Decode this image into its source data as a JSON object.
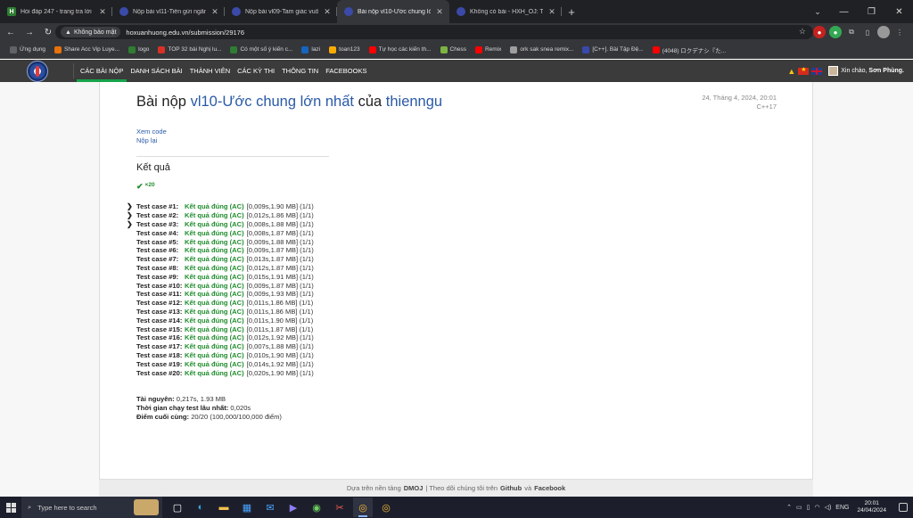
{
  "browser": {
    "tabs": [
      {
        "title": "Hỏi đáp 247 - trang tra lời",
        "favicon": "H",
        "active": false
      },
      {
        "title": "Nộp bài vl11-Tiền gửi ngân hà",
        "favicon": "",
        "active": false
      },
      {
        "title": "Nộp bài vl09-Tam giác vuông",
        "favicon": "",
        "active": false
      },
      {
        "title": "Bài nộp vl10-Ước chung lớn nh",
        "favicon": "",
        "active": true
      },
      {
        "title": "Không có bài - HXH_OJ: Trườn",
        "favicon": "",
        "active": false
      }
    ],
    "new_tab": "+",
    "security_label": "Không bảo mật",
    "url": "hoxuanhuong.edu.vn/submission/29176",
    "bookmarks": [
      {
        "label": "Ứng dụng",
        "icon": "apps-icon",
        "color": "#5f6368"
      },
      {
        "label": "Share Acc Vip Luye...",
        "icon": "share-icon",
        "color": "#e8710a"
      },
      {
        "label": "logo",
        "icon": "h-logo-icon",
        "color": "#2e7d32"
      },
      {
        "label": "TOP 32 bài Nghị lu...",
        "icon": "bookmark-icon",
        "color": "#d93025"
      },
      {
        "label": "Có một số ý kiến c...",
        "icon": "h-logo-icon",
        "color": "#2e7d32"
      },
      {
        "label": "lazi",
        "icon": "lazi-icon",
        "color": "#1565c0"
      },
      {
        "label": "toan123",
        "icon": "toan-icon",
        "color": "#f9ab00"
      },
      {
        "label": "Tự học các kiến th...",
        "icon": "youtube-icon",
        "color": "#ff0000"
      },
      {
        "label": "Chess",
        "icon": "chess-icon",
        "color": "#7cb342"
      },
      {
        "label": "Remix",
        "icon": "youtube-icon",
        "color": "#ff0000"
      },
      {
        "label": "ork sak snea remix...",
        "icon": "globe-icon",
        "color": "#9e9e9e"
      },
      {
        "label": "[C++]. Bài Tập Đệ...",
        "icon": "cpp-icon",
        "color": "#3949ab"
      },
      {
        "label": "(4048) ロクデナシ『た...",
        "icon": "youtube-icon",
        "color": "#ff0000"
      }
    ]
  },
  "site": {
    "menu": [
      "CÁC BÀI NỘP",
      "DANH SÁCH BÀI",
      "THÀNH VIÊN",
      "CÁC KỲ THI",
      "THÔNG TIN",
      "FACEBOOKS"
    ],
    "greeting_prefix": "Xin chào,",
    "user": "Sơn Phùng."
  },
  "submission": {
    "title_prefix": "Bài nộp",
    "problem": "vl10-Ước chung lớn nhất",
    "title_of": "của",
    "user": "thienngu",
    "date": "24, Tháng 4, 2024, 20:01",
    "language": "C++17",
    "view_code": "Xem code",
    "resubmit": "Nộp lại",
    "result_heading": "Kết quả",
    "summary_count": "×20",
    "verdict": "Kết quả đúng (AC)",
    "cases": [
      {
        "label": "Test case #1:",
        "info": "[0,009s,1.90 MB] (1/1)",
        "expandable": true
      },
      {
        "label": "Test case #2:",
        "info": "[0,012s,1.86 MB] (1/1)",
        "expandable": true
      },
      {
        "label": "Test case #3:",
        "info": "[0,008s,1.88 MB] (1/1)",
        "expandable": true
      },
      {
        "label": "Test case #4:",
        "info": "[0,008s,1.87 MB] (1/1)",
        "expandable": false
      },
      {
        "label": "Test case #5:",
        "info": "[0,009s,1.88 MB] (1/1)",
        "expandable": false
      },
      {
        "label": "Test case #6:",
        "info": "[0,009s,1.87 MB] (1/1)",
        "expandable": false
      },
      {
        "label": "Test case #7:",
        "info": "[0,013s,1.87 MB] (1/1)",
        "expandable": false
      },
      {
        "label": "Test case #8:",
        "info": "[0,012s,1.87 MB] (1/1)",
        "expandable": false
      },
      {
        "label": "Test case #9:",
        "info": "[0,015s,1.91 MB] (1/1)",
        "expandable": false
      },
      {
        "label": "Test case #10:",
        "info": "[0,009s,1.87 MB] (1/1)",
        "expandable": false
      },
      {
        "label": "Test case #11:",
        "info": "[0,009s,1.93 MB] (1/1)",
        "expandable": false
      },
      {
        "label": "Test case #12:",
        "info": "[0,011s,1.86 MB] (1/1)",
        "expandable": false
      },
      {
        "label": "Test case #13:",
        "info": "[0,011s,1.86 MB] (1/1)",
        "expandable": false
      },
      {
        "label": "Test case #14:",
        "info": "[0,011s,1.90 MB] (1/1)",
        "expandable": false
      },
      {
        "label": "Test case #15:",
        "info": "[0,011s,1.87 MB] (1/1)",
        "expandable": false
      },
      {
        "label": "Test case #16:",
        "info": "[0,012s,1.92 MB] (1/1)",
        "expandable": false
      },
      {
        "label": "Test case #17:",
        "info": "[0,007s,1.88 MB] (1/1)",
        "expandable": false
      },
      {
        "label": "Test case #18:",
        "info": "[0,010s,1.90 MB] (1/1)",
        "expandable": false
      },
      {
        "label": "Test case #19:",
        "info": "[0,014s,1.92 MB] (1/1)",
        "expandable": false
      },
      {
        "label": "Test case #20:",
        "info": "[0,020s,1.90 MB] (1/1)",
        "expandable": false
      }
    ],
    "resources_label": "Tài nguyên:",
    "resources_value": "0,217s, 1.93 MB",
    "max_time_label": "Thời gian chạy test lâu nhất:",
    "max_time_value": "0,020s",
    "final_score_label": "Điểm cuối cùng:",
    "final_score_value": "20/20 (100,000/100,000 điểm)"
  },
  "footer": {
    "prefix": "Dựa trên nền tảng",
    "dmoj": "DMOJ",
    "middle": "| Theo dõi chúng tôi trên",
    "github": "Github",
    "and": "và",
    "facebook": "Facebook"
  },
  "taskbar": {
    "search_placeholder": "Type here to search",
    "language": "ENG",
    "time": "20:01",
    "date": "24/04/2024"
  },
  "colors": {
    "accent_green": "#1f8c2d",
    "link_blue": "#2a5aa8",
    "navbar_bg": "#3b3b3b"
  }
}
